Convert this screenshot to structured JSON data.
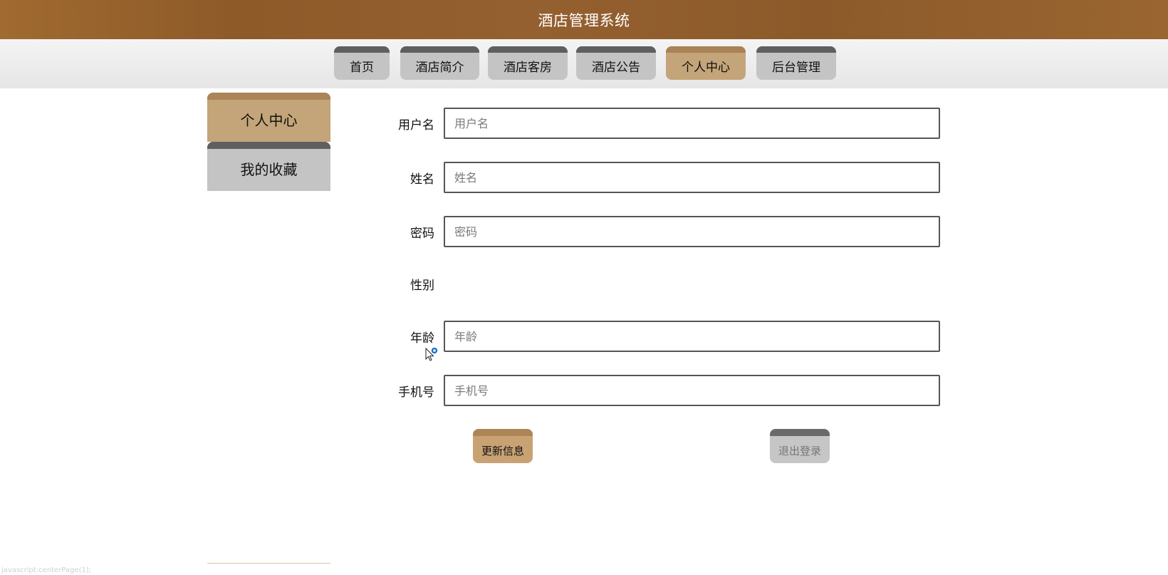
{
  "header": {
    "title": "酒店管理系统"
  },
  "nav": {
    "tabs": [
      {
        "label": "首页",
        "active": false
      },
      {
        "label": "酒店简介",
        "active": false
      },
      {
        "label": "酒店客房",
        "active": false
      },
      {
        "label": "酒店公告",
        "active": false
      },
      {
        "label": "个人中心",
        "active": true
      },
      {
        "label": "后台管理",
        "active": false
      }
    ]
  },
  "sidebar": {
    "items": [
      {
        "label": "个人中心",
        "active": true
      },
      {
        "label": "我的收藏",
        "active": false
      }
    ]
  },
  "form": {
    "username": {
      "label": "用户名",
      "placeholder": "用户名",
      "value": ""
    },
    "name": {
      "label": "姓名",
      "placeholder": "姓名",
      "value": ""
    },
    "password": {
      "label": "密码",
      "placeholder": "密码",
      "value": ""
    },
    "gender": {
      "label": "性别"
    },
    "age": {
      "label": "年龄",
      "placeholder": "年龄",
      "value": ""
    },
    "phone": {
      "label": "手机号",
      "placeholder": "手机号",
      "value": ""
    }
  },
  "actions": {
    "update_label": "更新信息",
    "logout_label": "退出登录"
  },
  "status": {
    "text": "javascript:centerPage(1);"
  },
  "colors": {
    "header_brown": "#8e5a28",
    "tab_active": "#c4a479",
    "tab_inactive": "#c4c4c4",
    "tab_top_dark": "#5f5f5f"
  }
}
